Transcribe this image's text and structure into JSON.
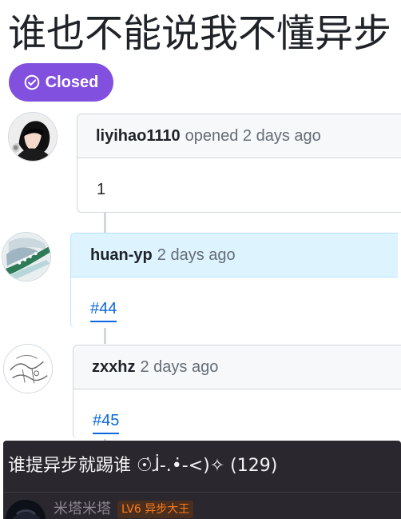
{
  "issue": {
    "title": "谁也不能说我不懂异步",
    "status_label": "Closed"
  },
  "timeline": [
    {
      "author": "liyihao1110",
      "action": "opened 2 days ago",
      "body": "1"
    },
    {
      "author": "huan-yp",
      "action": "2 days ago",
      "reference": "#44"
    },
    {
      "author": "zxxhz",
      "action": "2 days ago",
      "reference": "#45"
    }
  ],
  "overlay": {
    "title": "谁提异步就踢谁 ☉̇ɺ̇-.•̇-<)✧ (129)",
    "username": "米塔米塔",
    "badge": "LV6 异步大王"
  },
  "colors": {
    "closed": "#8250df",
    "link": "#0969da",
    "highlight_header": "#ddf4ff",
    "overlay_background": "#2b272e",
    "badge_text": "#ff7b1a"
  },
  "icons": {
    "status": "check-circle-icon"
  }
}
